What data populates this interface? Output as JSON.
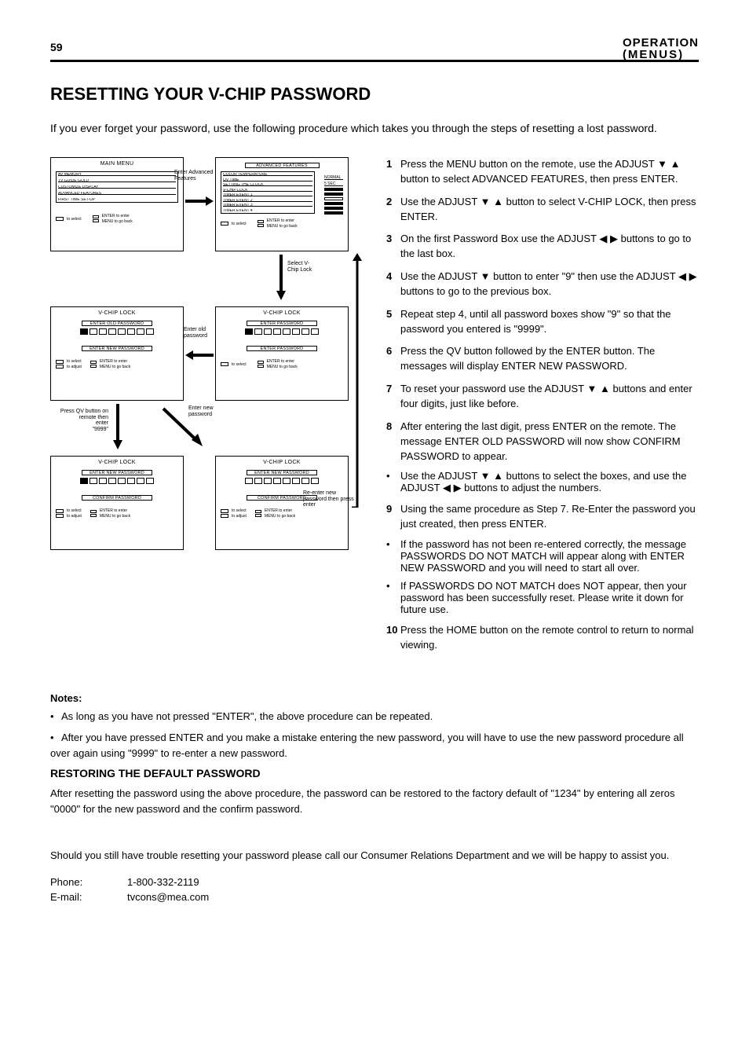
{
  "header": {
    "page_no": "59",
    "line1": "OPERATION",
    "line2": "(MENUS)"
  },
  "section": {
    "title": "RESETTING YOUR V-CHIP PASSWORD",
    "desc": "If you ever forget your password, use the following procedure which takes you through the steps of resetting a lost password."
  },
  "osd": {
    "main": {
      "title": "MAIN MENU",
      "items": [
        "AV MEMORY",
        "TV GUIDE GOLD",
        "CUSTOMIZE DISPLAY",
        "ADVANCED FEATURES",
        "FIRST TIME SET-UP"
      ],
      "foot_select": "to select",
      "foot_enter": "ENTER  to enter",
      "foot_menu": "MENU  to go back"
    },
    "adv": {
      "title": "ADVANCED FEATURES",
      "items": [
        "COLOR TEMPERATURE",
        "QV TIME",
        "SETTING THE CLOCK",
        "V-CHIP LOCK",
        "TIMER EVENT 1",
        "TIMER EVENT 2",
        "TIMER EVENT 3",
        "TIMER EVENT 4"
      ],
      "right": [
        "NORMAL",
        "5 SEC"
      ]
    },
    "vchip": {
      "title": "V-CHIP LOCK",
      "sub": "ENTER PASSWORD"
    },
    "new": {
      "sub": "ENTER NEW PASSWORD"
    },
    "old": {
      "sub": "ENTER OLD PASSWORD"
    },
    "confirm": {
      "sub": "CONFIRM PASSWORD"
    },
    "foot2": {
      "select": "to select",
      "adjust": "to adjust",
      "enter": "ENTER  to enter",
      "menu": "MENU  to go back"
    }
  },
  "arrows": {
    "a1_label": "Enter Advanced\nFeatures",
    "a2_label": "Select\nV-Chip\nLock",
    "a3_label": "Enter old\npassword",
    "a4_label_pre": "Press QV\nbutton on\nremote then",
    "a4_label_line2": "enter",
    "a4_label_line3": "\"9999\"",
    "a5_label": "Re-enter new\npassword  then\npress enter",
    "a6_label": "Enter new\npassword"
  },
  "steps": {
    "s1": {
      "n": "1",
      "t_pre": "Press the MENU button on the remote, use the ADJUST ",
      "t_post": " button to select ADVANCED FEATURES, then press ENTER."
    },
    "s2": {
      "n": "2",
      "t_pre": "Use the ADJUST ",
      "t_post": " button to select V-CHIP LOCK, then press ENTER."
    },
    "s3": {
      "n": "3",
      "t_pre": "On the first Password Box use the ADJUST ",
      "t_post": " buttons to go to the last box."
    },
    "s4": {
      "n": "4",
      "t_pre": "Use the ADJUST ",
      "t_mid": " button to enter \"9\" then use the ADJUST ",
      "t_post": " buttons to go to the previous box."
    },
    "s5": {
      "n": "5",
      "t": "Repeat step 4, until all password boxes show \"9\" so that the password you entered is \"9999\"."
    },
    "s6": {
      "n": "6",
      "t": "Press the QV button followed by the ENTER button. The messages will display ENTER NEW PASSWORD."
    },
    "s7": {
      "n": "7",
      "t_pre": "To reset your password use the ADJUST ",
      "t_post": "  buttons and enter four digits, just like before."
    },
    "s8": {
      "n": "8",
      "t": "After entering the last digit, press ENTER on the remote. The message ENTER OLD PASSWORD will now show CONFIRM PASSWORD to appear."
    },
    "note8": {
      "t_pre": "Use the ADJUST ",
      "t_mid": " buttons to select the boxes, and use the ADJUST ",
      "t_post": " buttons to adjust the numbers."
    },
    "s9": {
      "n": "9",
      "t": "Using the same procedure as Step 7. Re-Enter the password you just created, then press ENTER."
    },
    "note9_1": "If the password has not been re-entered correctly, the message PASSWORDS DO NOT MATCH will appear along with ENTER NEW PASSWORD and you will need to start all over.",
    "note9_2": "If PASSWORDS DO NOT MATCH does NOT appear, then your password has been successfully reset. Please write it down for future use.",
    "s10": {
      "n": "10",
      "t": "Press the HOME button on the remote control to return to normal viewing."
    }
  },
  "notes": {
    "h": "Notes:",
    "p1": "As long as you have not pressed \"ENTER\", the above procedure can be repeated.",
    "p2": "After you have pressed ENTER and you make a mistake entering the new password, you will have to use the new password procedure all over again using \"9999\" to re-enter a new password."
  },
  "restore": {
    "h": "RESTORING THE DEFAULT PASSWORD",
    "p": "After resetting the password using the above procedure, the password can be restored to the factory default of \"1234\" by entering all zeros \"0000\" for the new password and the confirm password."
  },
  "contact": {
    "p1": "Should you still have trouble resetting your password please call our Consumer Relations Department and we will be happy to assist you.",
    "phone_label": "Phone:",
    "phone": "1-800-332-2119",
    "email_label": "E-mail:",
    "email": "tvcons@mea.com"
  }
}
